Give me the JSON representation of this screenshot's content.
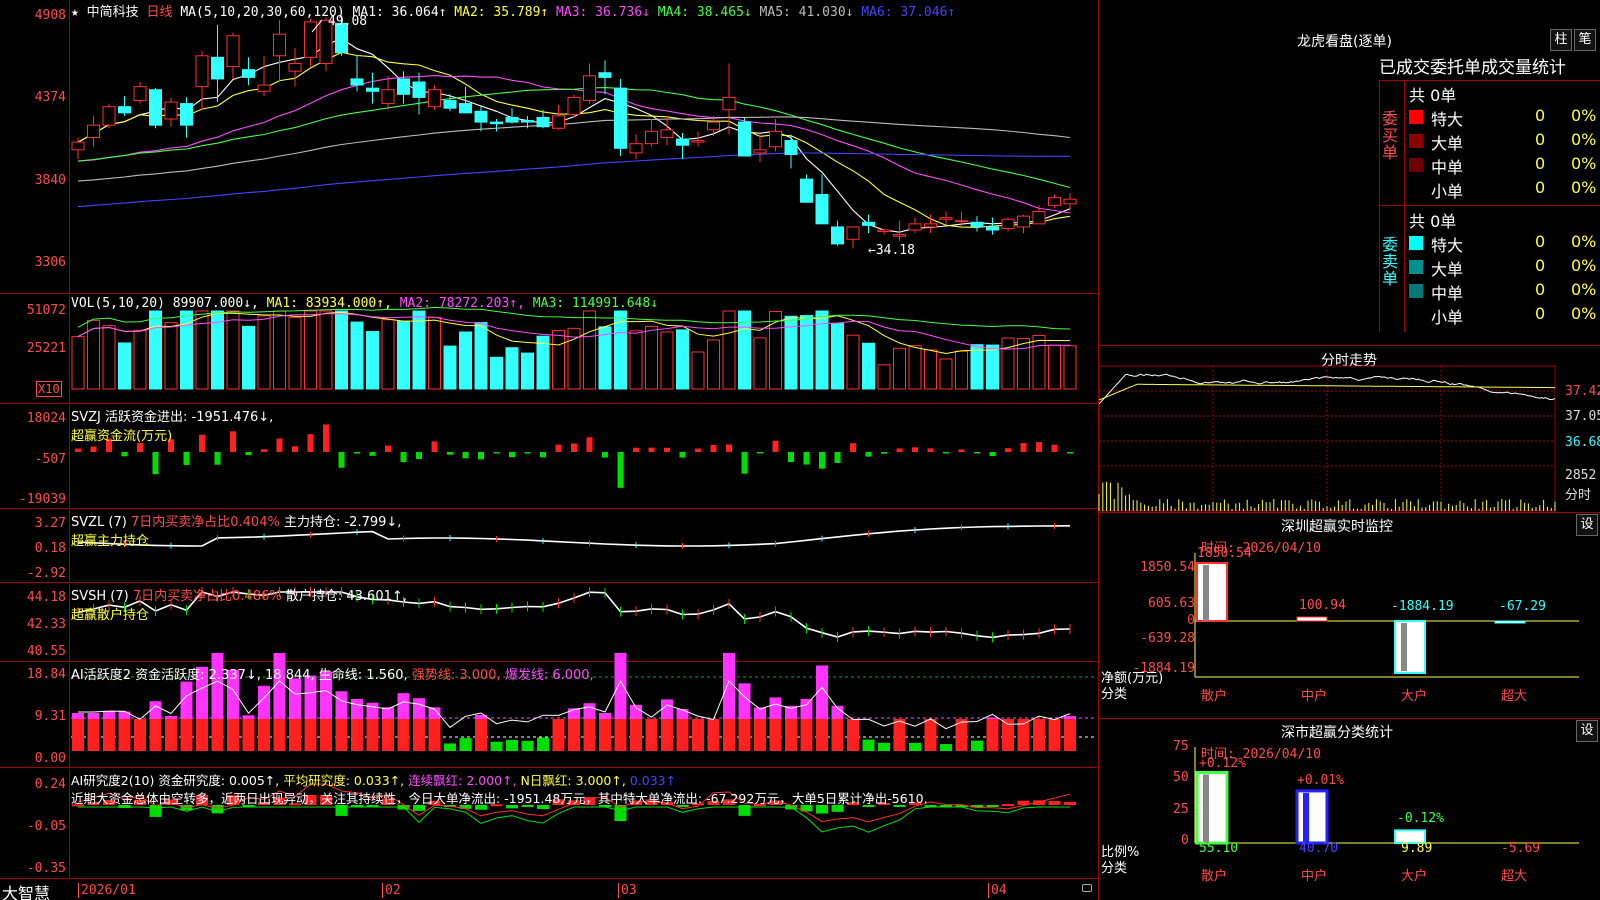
{
  "kline": {
    "star": "★",
    "name": "中简科技",
    "period": "日线",
    "ma_label": "MA(5,10,20,30,60,120)",
    "ma1": "MA1: 36.064↑",
    "ma2": "MA2: 35.789↑",
    "ma3": "MA3: 36.736↓",
    "ma4": "MA4: 38.465↓",
    "ma5": "MA5: 41.030↓",
    "ma6": "MA6: 37.046↑",
    "y_labels": [
      "4908",
      "4374",
      "3840",
      "3306"
    ],
    "high_note": "49.08",
    "low_note": "←34.18",
    "ohlc": [
      [
        40.4,
        41.2,
        39.8,
        40.9
      ],
      [
        41.2,
        42.6,
        40.6,
        42.0
      ],
      [
        42.0,
        43.4,
        41.8,
        43.2
      ],
      [
        43.2,
        43.9,
        42.6,
        42.8
      ],
      [
        43.6,
        44.8,
        43.4,
        44.5
      ],
      [
        44.3,
        44.4,
        41.8,
        42.0
      ],
      [
        42.4,
        43.8,
        41.9,
        43.5
      ],
      [
        43.4,
        43.8,
        41.2,
        42.0
      ],
      [
        44.5,
        46.8,
        43.0,
        46.5
      ],
      [
        46.4,
        48.5,
        43.5,
        45.0
      ],
      [
        45.8,
        48.0,
        45.0,
        47.8
      ],
      [
        45.6,
        46.4,
        44.6,
        45.1
      ],
      [
        44.2,
        46.5,
        43.9,
        44.6
      ],
      [
        46.5,
        48.8,
        44.8,
        47.9
      ],
      [
        45.5,
        47.0,
        44.5,
        46.0
      ],
      [
        46.4,
        48.9,
        45.8,
        48.7
      ],
      [
        46.0,
        49.0,
        45.5,
        48.8
      ],
      [
        48.6,
        49.08,
        46.5,
        46.7
      ],
      [
        45.0,
        46.5,
        44.2,
        44.6
      ],
      [
        44.4,
        45.4,
        43.4,
        44.2
      ],
      [
        43.4,
        45.2,
        43.0,
        44.3
      ],
      [
        45.0,
        45.5,
        43.4,
        44.0
      ],
      [
        44.8,
        45.4,
        42.7,
        43.8
      ],
      [
        43.2,
        44.6,
        43.0,
        44.3
      ],
      [
        43.6,
        44.0,
        42.9,
        43.1
      ],
      [
        43.4,
        44.5,
        42.9,
        42.8
      ],
      [
        42.9,
        43.3,
        41.6,
        42.2
      ],
      [
        42.2,
        42.4,
        41.6,
        42.1
      ],
      [
        42.5,
        43.1,
        42.1,
        42.2
      ],
      [
        42.3,
        42.6,
        41.8,
        42.2
      ],
      [
        42.5,
        43.0,
        41.8,
        41.9
      ],
      [
        41.8,
        43.3,
        41.7,
        42.6
      ],
      [
        42.7,
        44.0,
        42.5,
        43.8
      ],
      [
        43.6,
        46.0,
        43.4,
        45.2
      ],
      [
        45.4,
        46.2,
        44.0,
        45.1
      ],
      [
        44.4,
        45.0,
        40.0,
        40.5
      ],
      [
        40.2,
        41.4,
        39.8,
        40.8
      ],
      [
        40.8,
        42.4,
        40.6,
        41.6
      ],
      [
        41.2,
        42.6,
        40.7,
        41.7
      ],
      [
        41.1,
        41.5,
        39.8,
        40.7
      ],
      [
        40.9,
        41.6,
        40.6,
        41.0
      ],
      [
        41.7,
        42.6,
        41.3,
        42.2
      ],
      [
        43.0,
        46.0,
        41.4,
        43.8
      ],
      [
        42.2,
        42.5,
        40.0,
        40.0
      ],
      [
        40.2,
        41.4,
        39.6,
        40.4
      ],
      [
        40.6,
        42.4,
        40.3,
        41.6
      ],
      [
        41.0,
        41.4,
        39.2,
        40.1
      ],
      [
        38.5,
        38.8,
        37.0,
        37.0
      ],
      [
        37.5,
        38.8,
        35.6,
        35.6
      ],
      [
        35.4,
        35.8,
        34.18,
        34.3
      ],
      [
        34.6,
        35.0,
        34.0,
        35.4
      ],
      [
        35.7,
        36.2,
        35.0,
        35.5
      ],
      [
        35.1,
        35.3,
        34.9,
        35.2
      ],
      [
        34.8,
        35.8,
        34.5,
        34.9
      ],
      [
        35.2,
        36.0,
        35.0,
        35.6
      ],
      [
        35.4,
        36.2,
        35.0,
        35.6
      ],
      [
        35.9,
        36.4,
        35.6,
        36.0
      ],
      [
        35.8,
        36.4,
        35.3,
        35.8
      ],
      [
        35.7,
        36.1,
        35.1,
        35.4
      ],
      [
        35.4,
        36.0,
        34.9,
        35.2
      ],
      [
        35.3,
        36.0,
        35.1,
        35.9
      ],
      [
        35.4,
        36.2,
        35.0,
        36.1
      ],
      [
        35.6,
        36.8,
        35.6,
        36.4
      ],
      [
        36.8,
        37.5,
        36.6,
        37.3
      ],
      [
        36.9,
        37.6,
        36.5,
        37.2
      ]
    ]
  },
  "vol": {
    "label": "VOL(5,10,20)",
    "v": "89907.000↓,",
    "ma1": "MA1: 83934.000↑,",
    "ma2": "MA2: 78272.203↑,",
    "ma3": "MA3: 114991.648↓",
    "y_labels": [
      "51072",
      "25221"
    ],
    "x10": "X10"
  },
  "svzj": {
    "label": "SVZJ  活跃资金进出: -1951.476↓,",
    "sub": "超赢资金流(万元)",
    "y_labels": [
      "18024",
      "-507",
      "-19039"
    ]
  },
  "svzl": {
    "label": "SVZL (7)",
    "ratio": "7日内买卖净占比0.404%",
    "hold": "主力持仓: -2.799↓,",
    "sub": "超赢主力持仓",
    "y_labels": [
      "3.27",
      "0.18",
      "-2.92"
    ]
  },
  "svsh": {
    "label": "SVSH (7)",
    "ratio": "7日内买卖净占比0.486%",
    "hold": "散户持仓: 43.601↑,",
    "sub": "超赢散户持仓",
    "y_labels": [
      "44.18",
      "42.33",
      "40.55"
    ]
  },
  "ai1": {
    "label": "AI活跃度2 资金活跃度: 2.337↓,",
    "v2": "18.844,",
    "v3": "生命线: 1.560,",
    "v4": "强势线: 3.000,",
    "v5": "爆发线: 6.000,",
    "y_labels": [
      "18.84",
      "9.31",
      "0.00"
    ]
  },
  "ai2": {
    "label": "AI研究度2(10) 资金研究度: 0.005↑,",
    "v2": "平均研究度: 0.033↑,",
    "v3": "连续飘红: 2.000↑,",
    "v4": "N日飘红: 3.000↑,",
    "v5": "0.033↑",
    "comment": "近期大资金总体由空转多，近两日出现异动，关注其持续性，今日大单净流出: -1951.48万元，其中特大单净流出: -67.292万元，大单5日累计净出-5610.",
    "y_labels": [
      "0.24",
      "-0.05",
      "-0.35"
    ]
  },
  "xaxis": {
    "brand": "大智慧",
    "labels": [
      "2026/01",
      "02",
      "03",
      "04"
    ]
  },
  "right": {
    "lhb_title": "龙虎看盘(逐单)",
    "btn1": "柱",
    "btn2": "笔",
    "stats_title": "已成交委托单成交量统计",
    "buy_label": "委买单",
    "sell_label": "委卖单",
    "buy_total": "共 0单",
    "sell_total": "共 0单",
    "buy_rows": [
      {
        "name": "特大",
        "count": "0",
        "pct": "0%",
        "color": "#ff0000"
      },
      {
        "name": "大单",
        "count": "0",
        "pct": "0%",
        "color": "#8b0000"
      },
      {
        "name": "中单",
        "count": "0",
        "pct": "0%",
        "color": "#6e0000"
      },
      {
        "name": "小单",
        "count": "0",
        "pct": "0%",
        "color": "#000000"
      }
    ],
    "sell_rows": [
      {
        "name": "特大",
        "count": "0",
        "pct": "0%",
        "color": "#00ffff"
      },
      {
        "name": "大单",
        "count": "0",
        "pct": "0%",
        "color": "#009090"
      },
      {
        "name": "中单",
        "count": "0",
        "pct": "0%",
        "color": "#007878"
      },
      {
        "name": "小单",
        "count": "0",
        "pct": "0%",
        "color": "#000000"
      }
    ],
    "intraday_title": "分时走势",
    "intraday_y": [
      "37.42",
      "37.05",
      "36.68"
    ],
    "intraday_vol": "2852",
    "intraday_x": "分时",
    "monitor_title": "深圳超赢实时监控",
    "monitor_btn": "设",
    "monitor_time": "时间: 2026/04/10",
    "monitor_y": [
      "1850.54",
      "605.63",
      "0",
      "-639.28",
      "-1884.19"
    ],
    "monitor_unit1": "净额(万元)",
    "monitor_unit2": "分类",
    "monitor_cats": [
      "散户",
      "中户",
      "大户",
      "超大"
    ],
    "monitor_values": [
      "1850.54",
      "100.94",
      "-1884.19",
      "-67.29"
    ],
    "class_title": "深市超赢分类统计",
    "class_btn": "设",
    "class_time": "时间: 2026/04/10",
    "class_y": [
      "75",
      "50",
      "25",
      "0"
    ],
    "class_unit1": "比例%",
    "class_unit2": "分类",
    "class_cats": [
      "散户",
      "中户",
      "大户",
      "超大"
    ],
    "class_top": [
      "+0.12%",
      "+0.01%",
      "-0.12%",
      ""
    ],
    "class_values": [
      "55.10",
      "40.70",
      "9.89",
      "-5.69"
    ]
  }
}
